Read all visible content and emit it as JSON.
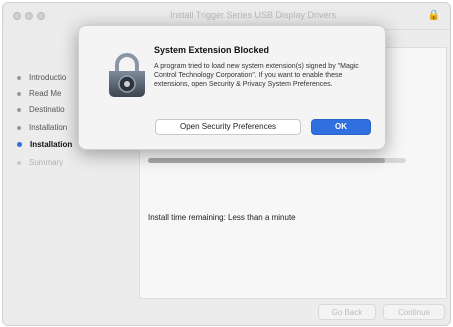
{
  "window": {
    "title": "Install Trigger Series USB Display Drivers"
  },
  "sidebar": {
    "items": [
      {
        "label": "Introductio",
        "state": "done"
      },
      {
        "label": "Read Me",
        "state": "done"
      },
      {
        "label": "Destinatio",
        "state": "done"
      },
      {
        "label": "Installation",
        "state": "done"
      },
      {
        "label": "Installation",
        "state": "active"
      },
      {
        "label": "Summary",
        "state": "future"
      }
    ]
  },
  "main": {
    "progress_fraction": 0.92,
    "time_remaining": "Install time remaining: Less than a minute"
  },
  "footer": {
    "back_label": "Go Back",
    "continue_label": "Continue"
  },
  "dialog": {
    "title": "System Extension Blocked",
    "message": "A program tried to load new system extension(s) signed by \"Magic Control Technology Corporation\". If you want to enable these extensions, open Security & Privacy System Preferences.",
    "open_prefs_label": "Open Security Preferences",
    "ok_label": "OK",
    "icon": "security-lock-icon"
  },
  "colors": {
    "accent": "#2f6fe0"
  }
}
